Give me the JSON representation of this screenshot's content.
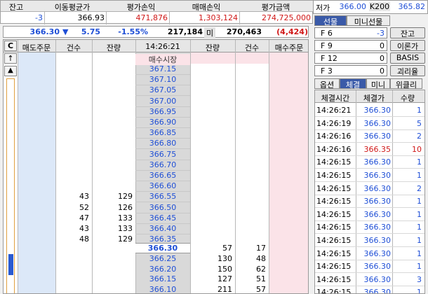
{
  "summary": {
    "headers": [
      "잔고",
      "이동평균가",
      "평가손익",
      "매매손익",
      "평가금액"
    ],
    "values": [
      "-3",
      "366.93",
      "471,876",
      "1,303,124",
      "274,725,000"
    ]
  },
  "price_bar": {
    "price": "366.30",
    "arrow": "▼",
    "change": "5.75",
    "rate": "-1.55%",
    "volume": "217,184",
    "unit": "미",
    "open_interest": "270,463",
    "oi_change": "(4,424)"
  },
  "orderbook": {
    "c_label": "C",
    "headers": [
      "매도주문",
      "건수",
      "잔량",
      "14:26:21",
      "잔량",
      "건수",
      "매수주문"
    ],
    "market_label": "매수시장",
    "ask_prices": [
      "367.15",
      "367.10",
      "367.05",
      "367.00",
      "366.95",
      "366.90",
      "366.85",
      "366.80",
      "366.75",
      "366.70",
      "366.65",
      "366.60",
      "366.55",
      "366.50",
      "366.45",
      "366.40",
      "366.35"
    ],
    "ask_counts": [
      "",
      "",
      "",
      "",
      "",
      "",
      "",
      "",
      "",
      "",
      "",
      "",
      "43",
      "52",
      "47",
      "43",
      "48"
    ],
    "ask_qty": [
      "",
      "",
      "",
      "",
      "",
      "",
      "",
      "",
      "",
      "",
      "",
      "",
      "129",
      "126",
      "133",
      "133",
      "129"
    ],
    "current_price": "366.30",
    "current_bid_qty": "57",
    "current_bid_count": "17",
    "bid_prices": [
      "366.25",
      "366.20",
      "366.15",
      "366.10"
    ],
    "bid_qty": [
      "130",
      "150",
      "127",
      "211"
    ],
    "bid_counts": [
      "48",
      "62",
      "51",
      "57"
    ],
    "scroll_up": "↑",
    "scroll_up2": "▲"
  },
  "right_panel": {
    "top_row": {
      "label": "저가",
      "low": "366.00",
      "k200_label": "K200",
      "k200": "365.82"
    },
    "tabs1": [
      "선물",
      "미니선물"
    ],
    "fkeys": [
      {
        "key": "F 6",
        "value": "-3",
        "button": "잔고"
      },
      {
        "key": "F 9",
        "value": "0",
        "button": "이론가"
      },
      {
        "key": "F 12",
        "value": "0",
        "button": "BASIS"
      },
      {
        "key": "F 3",
        "value": "0",
        "button": "괴리율"
      }
    ],
    "tabs2": [
      "옵션",
      "체결",
      "미니",
      "위클리"
    ],
    "trades_headers": [
      "체결시간",
      "체결가",
      "수량"
    ],
    "trades": [
      {
        "time": "14:26:21",
        "price": "366.30",
        "qty": "1",
        "qc": "#1f4fd6"
      },
      {
        "time": "14:26:19",
        "price": "366.30",
        "qty": "5",
        "qc": "#1f4fd6"
      },
      {
        "time": "14:26:16",
        "price": "366.30",
        "qty": "2",
        "qc": "#1f4fd6"
      },
      {
        "time": "14:26:16",
        "price": "366.35",
        "qty": "10",
        "qc": "#d01818"
      },
      {
        "time": "14:26:15",
        "price": "366.30",
        "qty": "1",
        "qc": "#1f4fd6"
      },
      {
        "time": "14:26:15",
        "price": "366.30",
        "qty": "1",
        "qc": "#1f4fd6"
      },
      {
        "time": "14:26:15",
        "price": "366.30",
        "qty": "2",
        "qc": "#1f4fd6"
      },
      {
        "time": "14:26:15",
        "price": "366.30",
        "qty": "1",
        "qc": "#1f4fd6"
      },
      {
        "time": "14:26:15",
        "price": "366.30",
        "qty": "1",
        "qc": "#1f4fd6"
      },
      {
        "time": "14:26:15",
        "price": "366.30",
        "qty": "1",
        "qc": "#1f4fd6"
      },
      {
        "time": "14:26:15",
        "price": "366.30",
        "qty": "1",
        "qc": "#1f4fd6"
      },
      {
        "time": "14:26:15",
        "price": "366.30",
        "qty": "1",
        "qc": "#1f4fd6"
      },
      {
        "time": "14:26:15",
        "price": "366.30",
        "qty": "1",
        "qc": "#1f4fd6"
      },
      {
        "time": "14:26:15",
        "price": "366.30",
        "qty": "3",
        "qc": "#1f4fd6"
      },
      {
        "time": "14:26:15",
        "price": "366.30",
        "qty": "1",
        "qc": "#1f4fd6"
      }
    ]
  },
  "colors": {
    "blue": "#1f4fd6",
    "red": "#d01818",
    "sell_col": "#dce8f8",
    "buy_col": "#fbe3e8",
    "price_col": "#d9d9d9",
    "tab_sel": "#3a5aa8"
  }
}
